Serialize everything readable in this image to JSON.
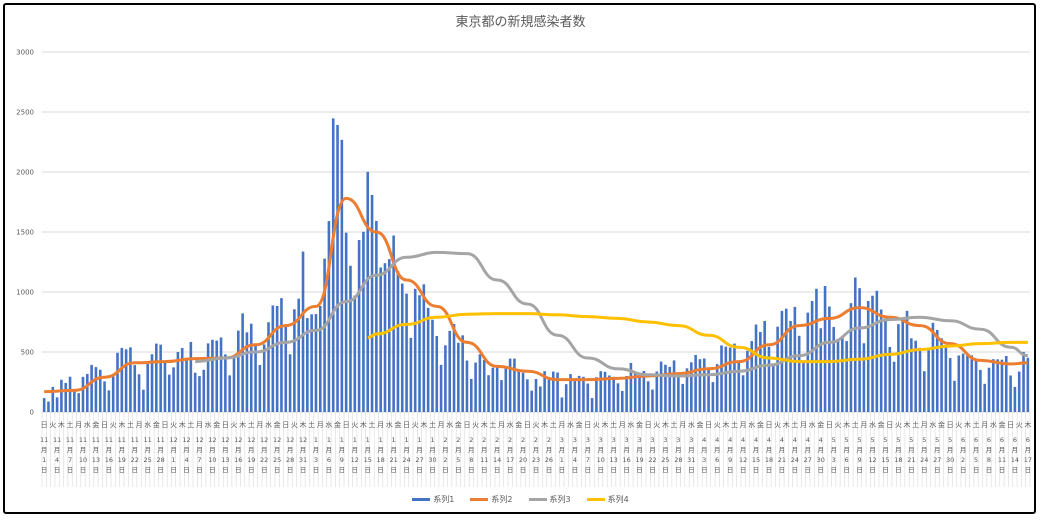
{
  "chart_data": {
    "type": "bar+line",
    "title": "東京都の新規感染者数",
    "ylim": [
      0,
      3000
    ],
    "yticks": [
      0,
      500,
      1000,
      1500,
      2000,
      2500,
      3000
    ],
    "grid": true,
    "legend_position": "bottom",
    "weekday_labels": [
      "日",
      "月",
      "火",
      "水",
      "木",
      "金",
      "土"
    ],
    "first_weekday": "日",
    "date_label_every": 3,
    "categories": [
      "11月1日",
      "11月2日",
      "11月3日",
      "11月4日",
      "11月5日",
      "11月6日",
      "11月7日",
      "11月8日",
      "11月9日",
      "11月10日",
      "11月11日",
      "11月12日",
      "11月13日",
      "11月14日",
      "11月15日",
      "11月16日",
      "11月17日",
      "11月18日",
      "11月19日",
      "11月20日",
      "11月21日",
      "11月22日",
      "11月23日",
      "11月24日",
      "11月25日",
      "11月26日",
      "11月27日",
      "11月28日",
      "11月29日",
      "11月30日",
      "12月1日",
      "12月2日",
      "12月3日",
      "12月4日",
      "12月5日",
      "12月6日",
      "12月7日",
      "12月8日",
      "12月9日",
      "12月10日",
      "12月11日",
      "12月12日",
      "12月13日",
      "12月14日",
      "12月15日",
      "12月16日",
      "12月17日",
      "12月18日",
      "12月19日",
      "12月20日",
      "12月21日",
      "12月22日",
      "12月23日",
      "12月24日",
      "12月25日",
      "12月26日",
      "12月27日",
      "12月28日",
      "12月29日",
      "12月30日",
      "12月31日",
      "1月1日",
      "1月2日",
      "1月3日",
      "1月4日",
      "1月5日",
      "1月6日",
      "1月7日",
      "1月8日",
      "1月9日",
      "1月10日",
      "1月11日",
      "1月12日",
      "1月13日",
      "1月14日",
      "1月15日",
      "1月16日",
      "1月17日",
      "1月18日",
      "1月19日",
      "1月20日",
      "1月21日",
      "1月22日",
      "1月23日",
      "1月24日",
      "1月25日",
      "1月26日",
      "1月27日",
      "1月28日",
      "1月29日",
      "1月30日",
      "1月31日",
      "2月1日",
      "2月2日",
      "2月3日",
      "2月4日",
      "2月5日",
      "2月6日",
      "2月7日",
      "2月8日",
      "2月9日",
      "2月10日",
      "2月11日",
      "2月12日",
      "2月13日",
      "2月14日",
      "2月15日",
      "2月16日",
      "2月17日",
      "2月18日",
      "2月19日",
      "2月20日",
      "2月21日",
      "2月22日",
      "2月23日",
      "2月24日",
      "2月25日",
      "2月26日",
      "2月27日",
      "2月28日",
      "3月1日",
      "3月2日",
      "3月3日",
      "3月4日",
      "3月5日",
      "3月6日",
      "3月7日",
      "3月8日",
      "3月9日",
      "3月10日",
      "3月11日",
      "3月12日",
      "3月13日",
      "3月14日",
      "3月15日",
      "3月16日",
      "3月17日",
      "3月18日",
      "3月19日",
      "3月20日",
      "3月21日",
      "3月22日",
      "3月23日",
      "3月24日",
      "3月25日",
      "3月26日",
      "3月27日",
      "3月28日",
      "3月29日",
      "3月30日",
      "3月31日",
      "4月1日",
      "4月2日",
      "4月3日",
      "4月4日",
      "4月5日",
      "4月6日",
      "4月7日",
      "4月8日",
      "4月9日",
      "4月10日",
      "4月11日",
      "4月12日",
      "4月13日",
      "4月14日",
      "4月15日",
      "4月16日",
      "4月17日",
      "4月18日",
      "4月19日",
      "4月20日",
      "4月21日",
      "4月22日",
      "4月23日",
      "4月24日",
      "4月25日",
      "4月26日",
      "4月27日",
      "4月28日",
      "4月29日",
      "4月30日",
      "5月1日",
      "5月2日",
      "5月3日",
      "5月4日",
      "5月5日",
      "5月6日",
      "5月7日",
      "5月8日",
      "5月9日",
      "5月10日",
      "5月11日",
      "5月12日",
      "5月13日",
      "5月14日",
      "5月15日",
      "5月16日",
      "5月17日",
      "5月18日",
      "5月19日",
      "5月20日",
      "5月21日",
      "5月22日",
      "5月23日",
      "5月24日",
      "5月25日",
      "5月26日",
      "5月27日",
      "5月28日",
      "5月29日",
      "5月30日",
      "5月31日",
      "6月1日",
      "6月2日",
      "6月3日",
      "6月4日",
      "6月5日",
      "6月6日",
      "6月7日",
      "6月8日",
      "6月9日",
      "6月10日",
      "6月11日",
      "6月12日",
      "6月13日",
      "6月14日",
      "6月15日",
      "6月16日",
      "6月17日"
    ],
    "series": [
      {
        "name": "系列1",
        "type": "bar",
        "color": "#4472C4",
        "values": [
          116,
          87,
          209,
          122,
          269,
          242,
          294,
          189,
          157,
          293,
          317,
          393,
          374,
          352,
          255,
          180,
          298,
          493,
          534,
          522,
          539,
          391,
          314,
          186,
          401,
          481,
          570,
          561,
          418,
          311,
          372,
          500,
          533,
          449,
          584,
          327,
          299,
          352,
          572,
          602,
          595,
          621,
          480,
          305,
          460,
          678,
          822,
          664,
          736,
          556,
          392,
          563,
          748,
          888,
          884,
          949,
          708,
          481,
          856,
          944,
          1337,
          783,
          814,
          816,
          884,
          1278,
          1591,
          2447,
          2392,
          2268,
          1494,
          1219,
          970,
          1433,
          1502,
          2001,
          1809,
          1592,
          1204,
          1240,
          1274,
          1471,
          1175,
          1070,
          986,
          618,
          1026,
          973,
          1064,
          868,
          769,
          633,
          393,
          556,
          676,
          734,
          577,
          639,
          429,
          276,
          412,
          481,
          434,
          307,
          369,
          371,
          266,
          378,
          445,
          445,
          353,
          327,
          272,
          178,
          275,
          213,
          340,
          270,
          337,
          329,
          121,
          232,
          316,
          279,
          301,
          293,
          237,
          116,
          290,
          340,
          335,
          304,
          293,
          239,
          175,
          300,
          409,
          323,
          303,
          342,
          256,
          187,
          337,
          420,
          394,
          376,
          430,
          313,
          234,
          364,
          414,
          475,
          440,
          446,
          355,
          249,
          399,
          555,
          545,
          537,
          570,
          421,
          306,
          510,
          591,
          729,
          667,
          759,
          543,
          405,
          711,
          843,
          861,
          759,
          876,
          635,
          425,
          828,
          925,
          1027,
          698,
          1050,
          879,
          708,
          609,
          621,
          591,
          907,
          1121,
          1032,
          573,
          925,
          969,
          1010,
          854,
          772,
          542,
          419,
          732,
          766,
          843,
          614,
          594,
          535,
          340,
          535,
          743,
          684,
          614,
          539,
          449,
          260,
          471,
          487,
          471,
          472,
          436,
          351,
          235,
          369,
          440,
          439,
          436,
          467,
          304,
          209,
          337,
          501,
          452
        ]
      },
      {
        "name": "系列2",
        "type": "line",
        "color": "#ED7D31",
        "x": [
          "11月1日",
          "11月8日",
          "11月15日",
          "11月22日",
          "11月29日",
          "12月6日",
          "12月13日",
          "12月20日",
          "12月27日",
          "1月3日",
          "1月10日",
          "1月17日",
          "1月24日",
          "1月31日",
          "2月7日",
          "2月14日",
          "2月21日",
          "2月28日",
          "3月7日",
          "3月14日",
          "3月21日",
          "3月28日",
          "4月4日",
          "4月11日",
          "4月18日",
          "4月25日",
          "5月2日",
          "5月9日",
          "5月16日",
          "5月23日",
          "5月30日",
          "6月6日",
          "6月13日",
          "6月17日"
        ],
        "values": [
          170,
          180,
          290,
          410,
          420,
          445,
          450,
          560,
          720,
          880,
          1780,
          1500,
          1100,
          880,
          580,
          380,
          340,
          270,
          270,
          280,
          300,
          320,
          360,
          420,
          560,
          720,
          780,
          870,
          790,
          720,
          570,
          430,
          400,
          410
        ]
      },
      {
        "name": "系列3",
        "type": "line",
        "color": "#A5A5A5",
        "x": [
          "12月6日",
          "12月13日",
          "12月20日",
          "12月27日",
          "1月3日",
          "1月10日",
          "1月17日",
          "1月24日",
          "1月31日",
          "2月7日",
          "2月14日",
          "2月21日",
          "2月28日",
          "3月7日",
          "3月14日",
          "3月21日",
          "3月28日",
          "4月4日",
          "4月11日",
          "4月18日",
          "4月25日",
          "5月2日",
          "5月9日",
          "5月16日",
          "5月23日",
          "5月30日",
          "6月6日",
          "6月13日",
          "6月17日"
        ],
        "values": [
          420,
          450,
          500,
          580,
          680,
          920,
          1140,
          1290,
          1330,
          1320,
          1100,
          900,
          640,
          450,
          360,
          310,
          300,
          310,
          340,
          390,
          470,
          580,
          700,
          770,
          790,
          760,
          690,
          540,
          470
        ]
      },
      {
        "name": "系列4",
        "type": "line",
        "color": "#FFC000",
        "x": [
          "1月15日",
          "1月17日",
          "1月24日",
          "1月31日",
          "2月7日",
          "2月14日",
          "2月21日",
          "2月28日",
          "3月7日",
          "3月14日",
          "3月21日",
          "3月28日",
          "4月4日",
          "4月11日",
          "4月18日",
          "4月25日",
          "5月2日",
          "5月9日",
          "5月16日",
          "5月23日",
          "5月30日",
          "6月6日",
          "6月13日",
          "6月17日"
        ],
        "values": [
          620,
          650,
          730,
          790,
          815,
          820,
          820,
          810,
          795,
          780,
          750,
          720,
          640,
          540,
          450,
          420,
          420,
          440,
          480,
          520,
          550,
          570,
          580,
          580
        ]
      }
    ]
  }
}
